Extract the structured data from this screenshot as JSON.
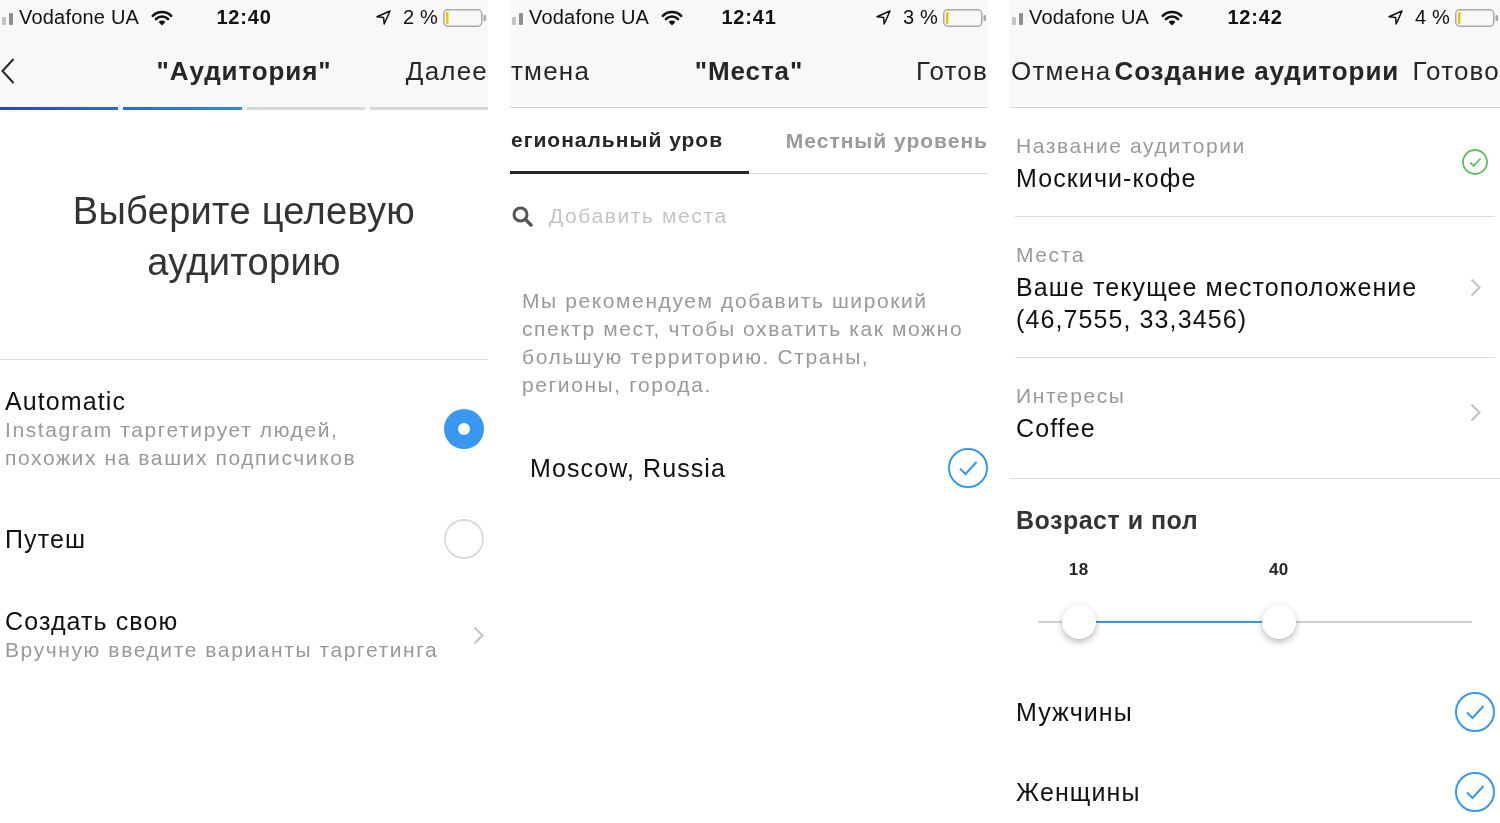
{
  "screens": [
    {
      "kind": "audience",
      "status_bar": {
        "carrier": "Vodafone UA",
        "time": "12:40",
        "battery": "2 %"
      },
      "nav_bar": {
        "title": "\"Аудитория\"",
        "right": "Далее",
        "steps": [
          {
            "done": true
          },
          {
            "done": true
          },
          {
            "done": false
          },
          {
            "done": false
          }
        ]
      },
      "heading": "Выберите целевую аудиторию",
      "options": [
        {
          "kind": "radio",
          "title": "Automatic",
          "description": "Instagram таргетирует людей, похожих на ваших подписчиков",
          "selected": true
        },
        {
          "kind": "radio",
          "title": "Путеш",
          "selected": false
        },
        {
          "kind": "link",
          "title": "Создать свою",
          "description": "Вручную введите варианты таргетинга"
        }
      ]
    },
    {
      "kind": "places",
      "status_bar": {
        "carrier": "Vodafone UA",
        "time": "12:41",
        "battery": "3 %"
      },
      "nav_bar": {
        "left": "тмена",
        "title": "\"Места\"",
        "right": "Готов"
      },
      "tabs": [
        {
          "label": "егиональный уров",
          "selected": true
        },
        {
          "label": "Местный уровень",
          "selected": false
        }
      ],
      "search": {
        "placeholder": "Добавить места"
      },
      "hint": "Мы рекомендуем добавить широкий спектр мест, чтобы охватить как можно большую территорию. Страны, регионы, города.",
      "places": [
        {
          "name": "Moscow, Russia",
          "checked": true
        }
      ]
    },
    {
      "kind": "create",
      "status_bar": {
        "carrier": "Vodafone UA",
        "time": "12:42",
        "battery": "4 %"
      },
      "nav_bar": {
        "left": "Отмена",
        "title": "Создание аудитории",
        "right": "Готово"
      },
      "fields": [
        {
          "kind": "valid",
          "label": "Название аудитории",
          "value": "Москичи-кофе"
        },
        {
          "kind": "link",
          "label": "Места",
          "value": "Ваше текущее местоположение (46,7555, 33,3456)"
        },
        {
          "kind": "link",
          "label": "Интересы",
          "value": "Coffee"
        }
      ],
      "age_gender": {
        "title": "Возраст и пол",
        "age_range": [
          {
            "label": "18",
            "level": 0.094
          },
          {
            "label": "40",
            "level": 0.555
          }
        ],
        "genders": [
          {
            "label": "Мужчины",
            "checked": true
          },
          {
            "label": "Женщины",
            "checked": true
          }
        ]
      }
    }
  ]
}
